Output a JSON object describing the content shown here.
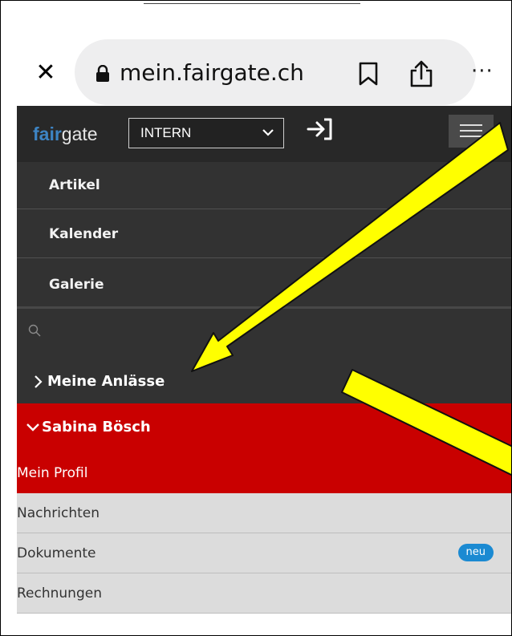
{
  "browser": {
    "close_glyph": "✕",
    "url": "mein.fairgate.ch",
    "more_glyph": "···",
    "icons": [
      "close-icon",
      "lock-icon",
      "bookmark-icon",
      "share-icon",
      "more-icon"
    ]
  },
  "header": {
    "logo_fair": "fair",
    "logo_gate": "gate",
    "select_value": "INTERN",
    "icons": [
      "chevron-down-icon",
      "login-icon",
      "hamburger-menu-icon"
    ]
  },
  "nav": {
    "items": [
      {
        "label": "Artikel"
      },
      {
        "label": "Kalender"
      },
      {
        "label": "Galerie"
      }
    ],
    "search_icon": "search-icon",
    "anlaesse_label": "Meine Anlässe"
  },
  "user": {
    "name": "Sabina Bösch",
    "profile_label": "Mein Profil"
  },
  "list": {
    "items": [
      {
        "label": "Nachrichten"
      },
      {
        "label": "Dokumente",
        "badge": "neu"
      },
      {
        "label": "Rechnungen"
      }
    ]
  },
  "colors": {
    "header_bg": "#282828",
    "nav_bg": "#323232",
    "red": "#c90000",
    "grey": "#dcdcdc",
    "badge": "#1b8ad2",
    "logo_blue": "#3d84c4",
    "arrow_fill": "#ffff00"
  }
}
